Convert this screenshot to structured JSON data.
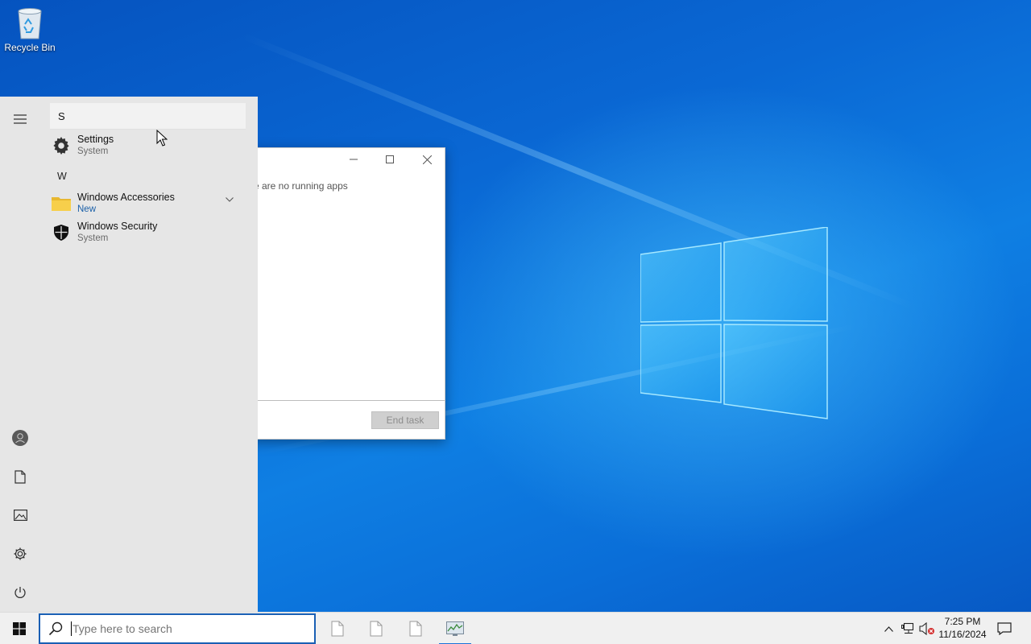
{
  "desktop": {
    "icons": [
      {
        "label": "Recycle Bin",
        "icon": "recycle-bin-icon"
      }
    ]
  },
  "task_manager": {
    "empty_text": "re are no running apps",
    "end_task_label": "End task",
    "controls": [
      "minimize",
      "maximize",
      "close"
    ]
  },
  "start_menu": {
    "search_query": "S",
    "results": [
      {
        "name": "Settings",
        "subtitle": "System",
        "icon": "gear-icon"
      },
      {
        "name": "Windows Accessories",
        "subtitle": "New",
        "icon": "folder-icon"
      },
      {
        "name": "Windows Security",
        "subtitle": "System",
        "icon": "shield-icon"
      }
    ],
    "group_header": "W",
    "rail_items": [
      "menu-icon",
      "user-avatar",
      "documents-icon",
      "pictures-icon",
      "settings-icon",
      "power-icon"
    ]
  },
  "taskbar": {
    "search_placeholder": "Type here to search",
    "pinned_apps": [
      "document-icon",
      "document-icon",
      "document-icon",
      "task-manager-icon"
    ],
    "active_app_index": 3,
    "clock": {
      "time": "7:25 PM",
      "date": "11/16/2024"
    },
    "tray_icons": [
      "chevron-up-icon",
      "network-icon",
      "volume-muted-icon",
      "notification-icon"
    ]
  },
  "colors": {
    "accent": "#1a5fb4",
    "start_bg": "#e6e6e6",
    "taskbar_bg": "#f0f0f0"
  }
}
